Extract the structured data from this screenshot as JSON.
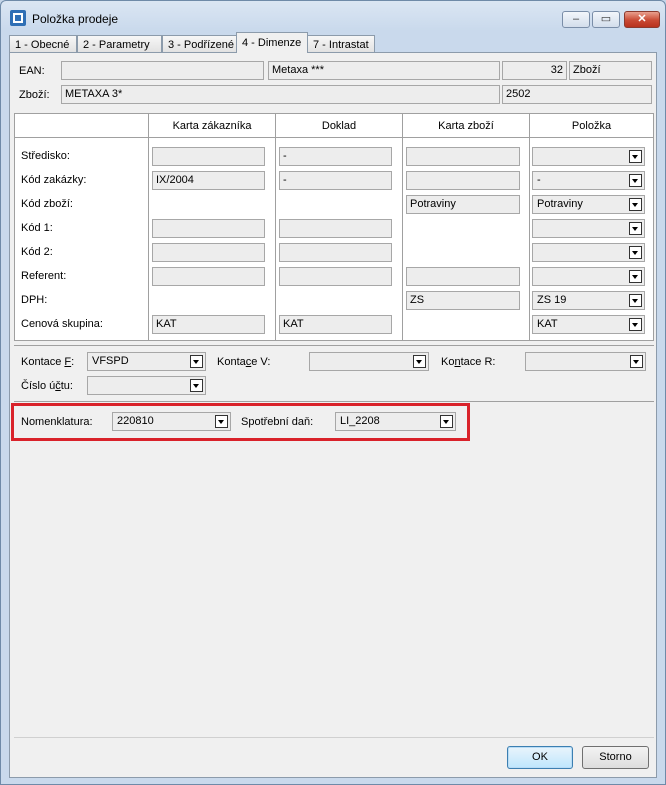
{
  "window": {
    "title": "Položka prodeje",
    "minimize_glyph": "–",
    "maximize_glyph": "▭",
    "close_glyph": "✕",
    "icon": "app-icon",
    "accent_color": "#d9222a"
  },
  "tabs": [
    {
      "label": "1 - Obecné",
      "active": false
    },
    {
      "label": "2 - Parametry",
      "active": false
    },
    {
      "label": "3 - Podřízené",
      "active": false
    },
    {
      "label": "4 - Dimenze",
      "active": true
    },
    {
      "label": "7 - Intrastat",
      "active": false
    }
  ],
  "header": {
    "ean_label": "EAN:",
    "ean_value": "",
    "name_value": "Metaxa ***",
    "qty_value": "32",
    "type_value": "Zboží",
    "goods_label": "Zboží:",
    "goods_value": "METAXA 3*",
    "goods_code": "2502"
  },
  "grid": {
    "columns": [
      "Karta zákazníka",
      "Doklad",
      "Karta zboží",
      "Položka"
    ],
    "rows": [
      {
        "label": "Středisko:",
        "c1": "",
        "c2": "-",
        "c3": "",
        "c4": ""
      },
      {
        "label": "Kód zakázky:",
        "c1": "IX/2004",
        "c2": "-",
        "c3": "",
        "c4": "-"
      },
      {
        "label": "Kód zboží:",
        "c3": "Potraviny",
        "c4": "Potraviny"
      },
      {
        "label": "Kód 1:",
        "c1": "",
        "c2": "",
        "c4": ""
      },
      {
        "label": "Kód 2:",
        "c1": "",
        "c2": "",
        "c4": ""
      },
      {
        "label": "Referent:",
        "c1": "",
        "c2": "",
        "c3": "",
        "c4": ""
      },
      {
        "label": "DPH:",
        "c3": "ZS",
        "c4": "ZS 19"
      },
      {
        "label": "Cenová skupina:",
        "c1": "KAT",
        "c2": "KAT",
        "c4": "KAT"
      }
    ]
  },
  "accounting": {
    "kontace_f_pre": "Kontace ",
    "kontace_f_key": "F",
    "kontace_f_post": ":",
    "kontace_f_value": "VFSPD",
    "kontace_v_pre": "Konta",
    "kontace_v_key": "c",
    "kontace_v_post": "e V:",
    "kontace_v_value": "",
    "kontace_r_pre": "Ko",
    "kontace_r_key": "n",
    "kontace_r_post": "tace R:",
    "kontace_r_value": "",
    "cislo_pre": "Číslo ú",
    "cislo_key": "č",
    "cislo_post": "tu:",
    "cislo_value": ""
  },
  "tax": {
    "nomenklatura_label": "Nomenklatura:",
    "nomenklatura_value": "220810",
    "spotrebni_label": "Spotřební daň:",
    "spotrebni_value": "LI_2208"
  },
  "buttons": {
    "ok": "OK",
    "storno": "Storno"
  }
}
